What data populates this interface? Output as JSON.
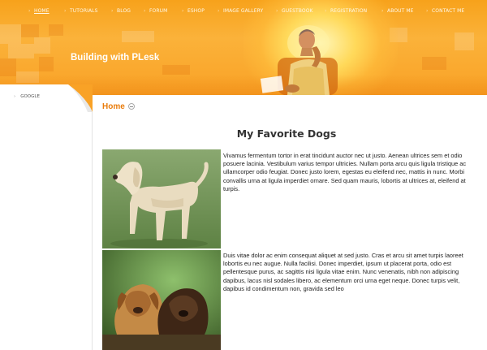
{
  "nav": [
    {
      "label": "HOME",
      "active": true
    },
    {
      "label": "TUTORIALS"
    },
    {
      "label": "BLOG"
    },
    {
      "label": "FORUM"
    },
    {
      "label": "ESHOP"
    },
    {
      "label": "IMAGE GALLERY"
    },
    {
      "label": "GUESTBOOK"
    },
    {
      "label": "REGISTRATION"
    },
    {
      "label": "ABOUT ME"
    },
    {
      "label": "CONTACT ME"
    }
  ],
  "header": {
    "site_title": "Building with PLesk"
  },
  "sidebar": {
    "links": [
      {
        "label": "GOOGLE"
      }
    ]
  },
  "breadcrumb": {
    "label": "Home"
  },
  "content": {
    "heading": "My Favorite Dogs",
    "paragraphs": [
      "Vivamus fermentum tortor in erat tincidunt auctor nec ut justo. Aenean ultrices sem et odio posuere lacinia. Vestibulum varius tempor ultricies. Nullam porta arcu quis ligula tristique ac ullamcorper odio feugiat. Donec justo lorem, egestas eu eleifend nec, mattis in nunc. Morbi convallis urna at ligula imperdiet ornare. Sed quam mauris, lobortis at ultrices at, eleifend at turpis.",
      " Duis vitae dolor ac enim consequat aliquet at sed justo. Cras et arcu sit amet turpis laoreet lobortis eu nec augue. Nulla facilisi. Donec imperdiet, ipsum ut placerat porta, odio est pellentesque purus, ac sagittis nisi ligula vitae enim. Nunc venenatis, nibh non adipiscing dapibus, lacus nisl sodales libero, ac elementum orci urna eget neque. Donec turpis velit, dapibus id condimentum non, gravida sed leo"
    ]
  },
  "colors": {
    "header_orange": "#f9a226",
    "accent": "#e97c0c"
  }
}
